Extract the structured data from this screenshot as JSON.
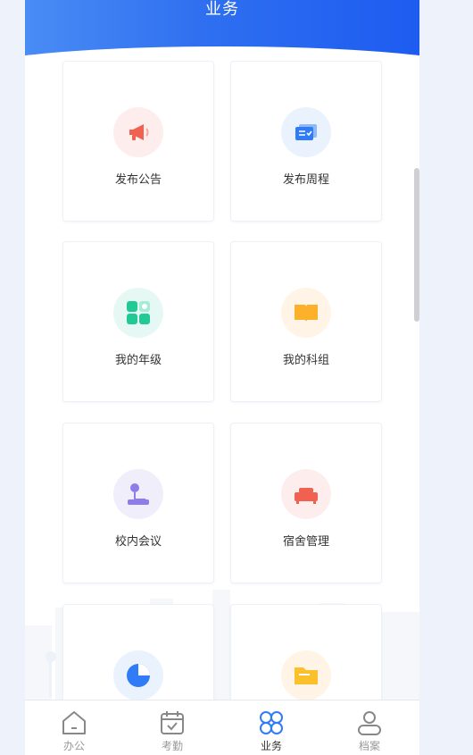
{
  "header": {
    "title": "业务"
  },
  "cards": [
    {
      "label": "发布公告",
      "icon": "megaphone-icon",
      "bg": "#fdeeed",
      "color": "#f0624f"
    },
    {
      "label": "发布周程",
      "icon": "schedule-icon",
      "bg": "#eaf2fe",
      "color": "#2f7cf6"
    },
    {
      "label": "我的年级",
      "icon": "grade-icon",
      "bg": "#e6f8f3",
      "color": "#21c995"
    },
    {
      "label": "我的科组",
      "icon": "book-icon",
      "bg": "#fff4e6",
      "color": "#fbb12a"
    },
    {
      "label": "校内会议",
      "icon": "microphone-icon",
      "bg": "#f1eefb",
      "color": "#8e7ce8"
    },
    {
      "label": "宿舍管理",
      "icon": "bed-icon",
      "bg": "#fdeeed",
      "color": "#f0624f"
    },
    {
      "label": "",
      "icon": "pie-chart-icon",
      "bg": "#eaf2fe",
      "color": "#2f7cf6"
    },
    {
      "label": "",
      "icon": "folder-icon",
      "bg": "#fff4e6",
      "color": "#fbc02a"
    }
  ],
  "tabbar": [
    {
      "label": "办公",
      "icon": "home-icon",
      "active": false
    },
    {
      "label": "考勤",
      "icon": "calendar-check-icon",
      "active": false
    },
    {
      "label": "业务",
      "icon": "business-icon",
      "active": true
    },
    {
      "label": "档案",
      "icon": "profile-icon",
      "active": false
    }
  ]
}
